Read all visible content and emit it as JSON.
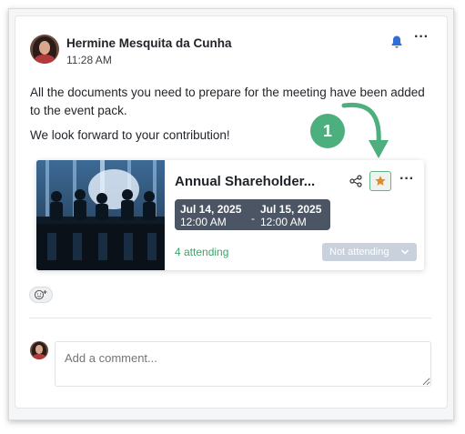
{
  "post": {
    "author": "Hermine Mesquita da Cunha",
    "time": "11:28 AM",
    "message_line1": "All the documents you need to prepare for the meeting have been added to the event pack.",
    "message_line2": "We look forward to your contribution!"
  },
  "event": {
    "title": "Annual Shareholder...",
    "start_date": "Jul 14, 2025",
    "start_time": "12:00 AM",
    "end_date": "Jul 15, 2025",
    "end_time": "12:00 AM",
    "separator": "-",
    "attending_count": "4 attending",
    "rsvp_label": "Not attending",
    "star_color": "#e08a2c"
  },
  "comment": {
    "placeholder": "Add a comment..."
  },
  "annotation": {
    "step": "1",
    "color": "#4caf7d"
  },
  "icons": {
    "notify": "bell-icon",
    "post_menu": "more-horizontal-icon",
    "share": "share-icon",
    "favorite": "star-icon",
    "event_menu": "more-horizontal-icon",
    "rsvp_toggle": "chevron-down-icon",
    "reaction": "emoji-add-icon"
  }
}
